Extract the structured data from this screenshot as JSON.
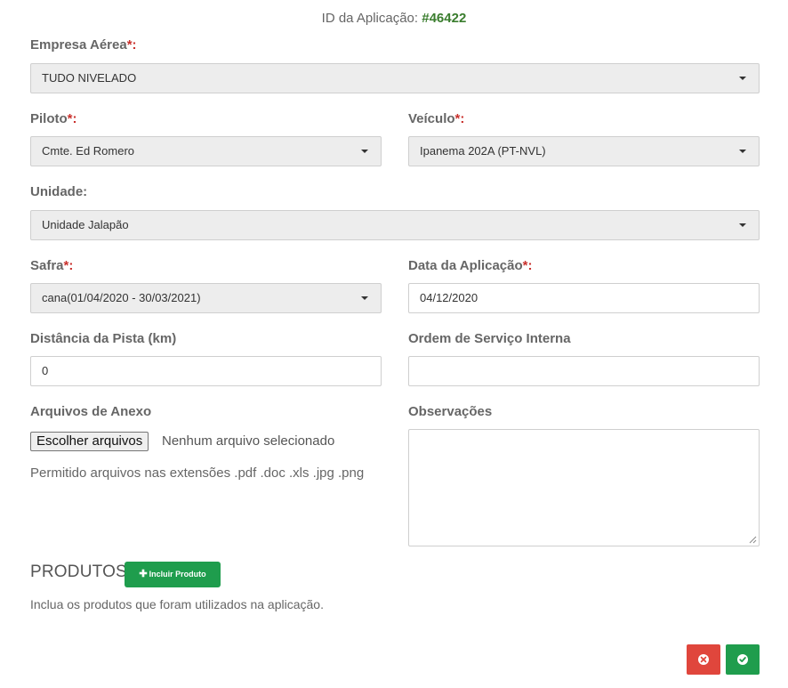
{
  "header": {
    "id_label": "ID da Aplicação:",
    "id_value": "#46422"
  },
  "fields": {
    "empresa": {
      "label": "Empresa Aérea",
      "required": "*:",
      "value": "TUDO NIVELADO"
    },
    "piloto": {
      "label": "Piloto",
      "required": "*:",
      "value": "Cmte. Ed Romero"
    },
    "veiculo": {
      "label": "Veículo",
      "required": "*:",
      "value": "Ipanema 202A (PT-NVL)"
    },
    "unidade": {
      "label": "Unidade:",
      "value": "Unidade Jalapão"
    },
    "safra": {
      "label": "Safra",
      "required": "*:",
      "value": "cana(01/04/2020 - 30/03/2021)"
    },
    "data": {
      "label": "Data da Aplicação",
      "required": "*:",
      "value": "04/12/2020"
    },
    "distancia": {
      "label": "Distância da Pista (km)",
      "value": "0"
    },
    "ordem": {
      "label": "Ordem de Serviço Interna",
      "value": ""
    },
    "anexo": {
      "label": "Arquivos de Anexo",
      "button": "Escolher arquivos",
      "status": "Nenhum arquivo selecionado",
      "hint": "Permitido arquivos nas extensões .pdf .doc .xls .jpg .png"
    },
    "observacoes": {
      "label": "Observações",
      "value": ""
    }
  },
  "produtos": {
    "title": "PRODUTOS",
    "add_button": "Incluir Produto",
    "description": "Inclua os produtos que foram utilizados na aplicação."
  },
  "actions": {
    "cancel_icon": "times-circle-icon",
    "confirm_icon": "check-circle-icon"
  },
  "colors": {
    "accent_green": "#1f9d4d",
    "danger_red": "#e0463c",
    "id_green": "#3a7d2e"
  }
}
